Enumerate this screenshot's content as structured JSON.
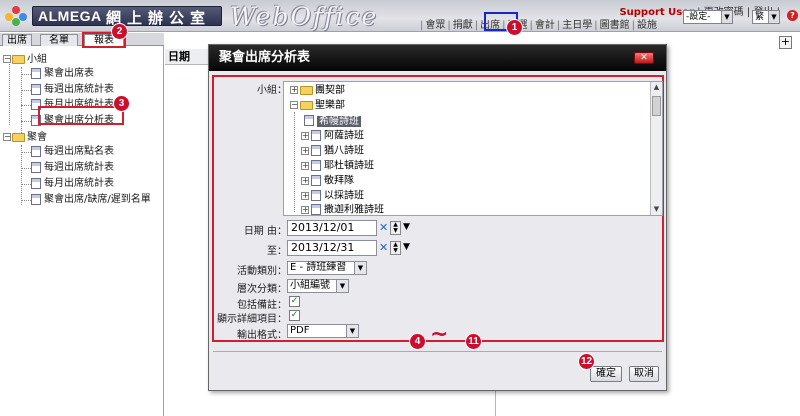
{
  "header": {
    "brand_name": "ALMEGA",
    "brand_cn": "網上辦公室",
    "brand_webo": "WebOffice",
    "user": "Support User",
    "user_links": [
      "更改密碼",
      "登出"
    ],
    "nav": [
      "會眾",
      "捐獻",
      "出席",
      "助選",
      "會計",
      "主日學",
      "圖書館",
      "設施"
    ],
    "settings_select": "-設定-",
    "lang_select": "繁"
  },
  "callouts": {
    "c1": "1",
    "c2": "2",
    "c3": "3",
    "c4": "4",
    "c11": "11",
    "c12": "12",
    "range_symbol": "~"
  },
  "left_panel": {
    "tabs": [
      "出席",
      "名單",
      "報表"
    ],
    "tree": {
      "group1": "小組",
      "group1_items": [
        "聚會出席表",
        "每週出席統計表",
        "每月出席統計表",
        "聚會出席分析表"
      ],
      "group2": "聚會",
      "group2_items": [
        "每週出席點名表",
        "每週出席統計表",
        "每月出席統計表",
        "聚會出席/缺席/遲到名單"
      ]
    }
  },
  "content": {
    "date_header": "日期",
    "add_button": "+"
  },
  "dialog": {
    "title": "聚會出席分析表",
    "close_label": "✕",
    "group_label": "小組：",
    "tree": [
      {
        "label": "團契部",
        "type": "folder",
        "level": 1,
        "expander": "+"
      },
      {
        "label": "聖樂部",
        "type": "folder",
        "level": 1,
        "expander": "−"
      },
      {
        "label": "希幔詩班",
        "type": "doc",
        "level": 2,
        "selected": true
      },
      {
        "label": "阿薩詩班",
        "type": "doc",
        "level": 2,
        "expander": "+"
      },
      {
        "label": "猶八詩班",
        "type": "doc",
        "level": 2,
        "expander": "+"
      },
      {
        "label": "耶杜頓詩班",
        "type": "doc",
        "level": 2,
        "expander": "+"
      },
      {
        "label": "敬拜隊",
        "type": "doc",
        "level": 2,
        "expander": "+"
      },
      {
        "label": "以採詩班",
        "type": "doc",
        "level": 2,
        "expander": "+"
      },
      {
        "label": "撒迦利雅詩班",
        "type": "doc",
        "level": 2,
        "expander": "+"
      }
    ],
    "date_from_label": "日期 由：",
    "date_from": "2013/12/01",
    "date_to_label": "至：",
    "date_to": "2013/12/31",
    "activity_label": "活動類別：",
    "activity": "E - 詩班練習",
    "level_label": "層次分類：",
    "level": "小組編號",
    "include_note_label": "包括備註：",
    "show_details_label": "顯示詳細項目：",
    "format_label": "輸出格式：",
    "format": "PDF",
    "ok_label": "確定",
    "cancel_label": "取消"
  }
}
